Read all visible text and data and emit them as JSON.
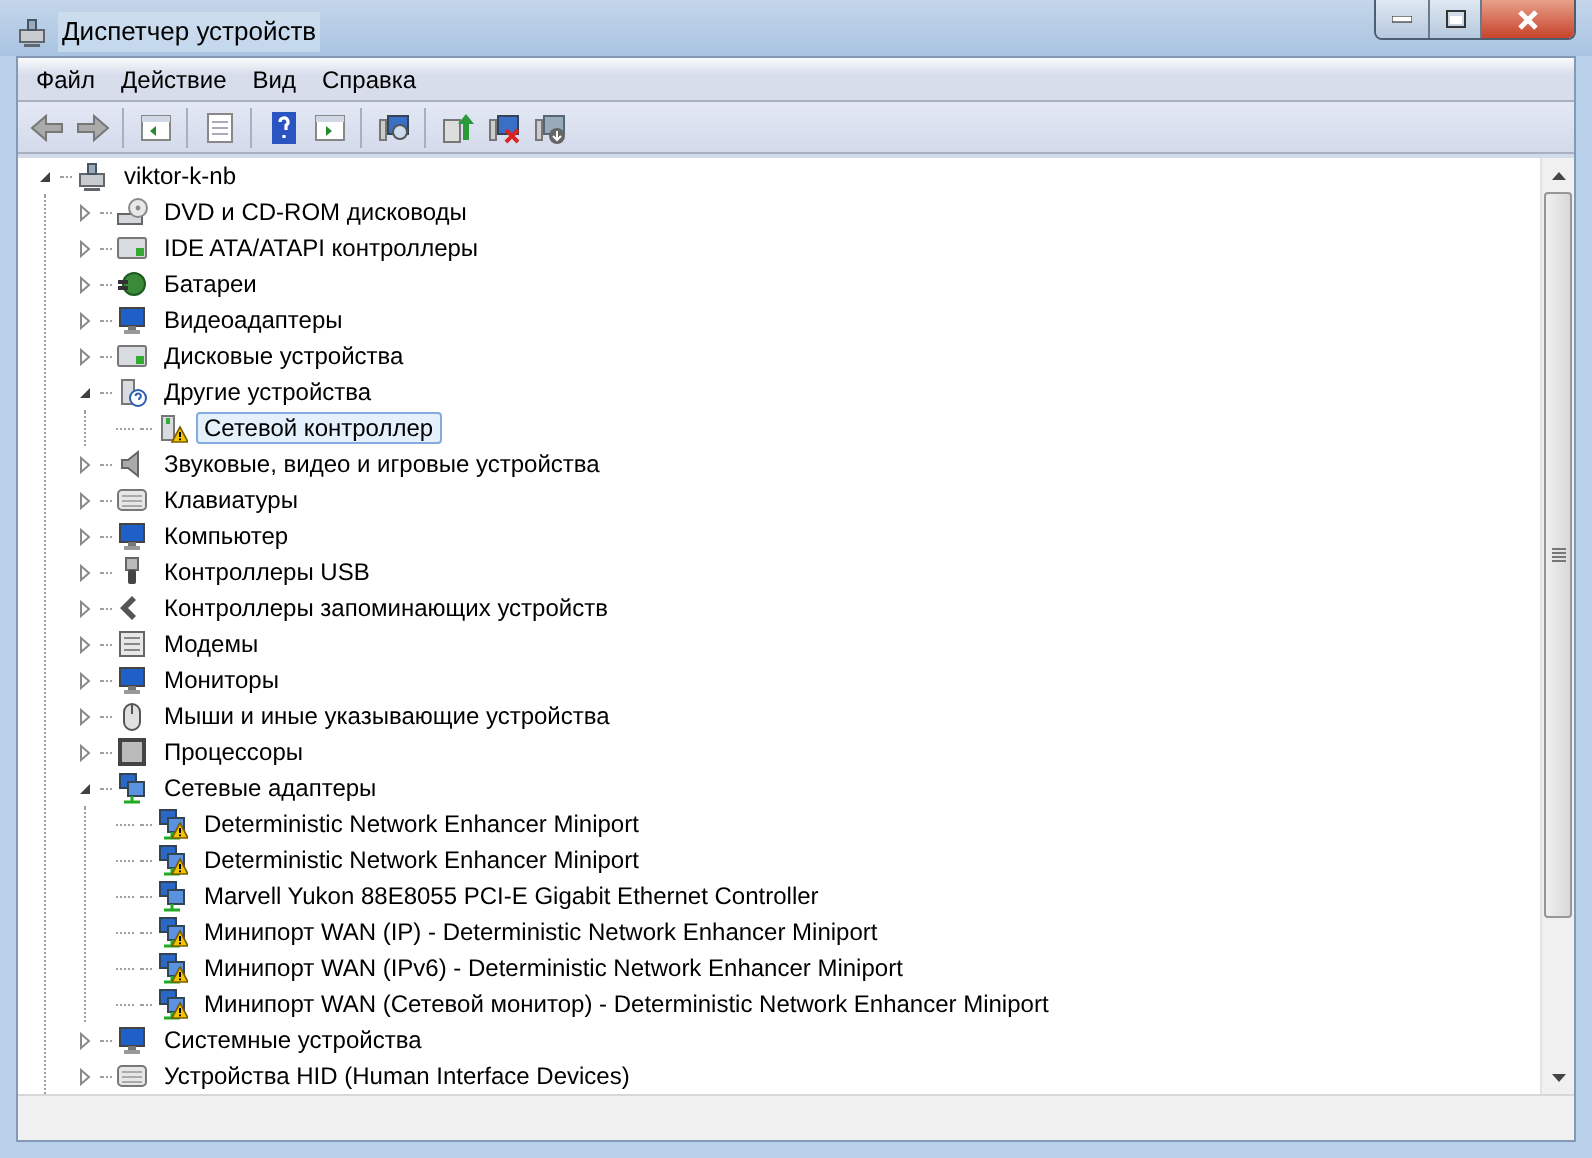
{
  "window": {
    "title": "Диспетчер устройств"
  },
  "menu": [
    "Файл",
    "Действие",
    "Вид",
    "Справка"
  ],
  "toolbar": [
    {
      "kind": "back",
      "disabled": true
    },
    {
      "kind": "forward",
      "disabled": true
    },
    {
      "kind": "sep"
    },
    {
      "kind": "panel"
    },
    {
      "kind": "sep"
    },
    {
      "kind": "properties"
    },
    {
      "kind": "sep"
    },
    {
      "kind": "help"
    },
    {
      "kind": "panel2"
    },
    {
      "kind": "sep"
    },
    {
      "kind": "scan"
    },
    {
      "kind": "sep"
    },
    {
      "kind": "update"
    },
    {
      "kind": "disable"
    },
    {
      "kind": "uninstall"
    }
  ],
  "tree": {
    "label": "viktor-k-nb",
    "kind": "computer",
    "expanded": true,
    "children": [
      {
        "label": "DVD и CD-ROM дисководы",
        "kind": "disc",
        "expanded": false
      },
      {
        "label": "IDE ATA/ATAPI контроллеры",
        "kind": "drive",
        "expanded": false
      },
      {
        "label": "Батареи",
        "kind": "battery",
        "expanded": false
      },
      {
        "label": "Видеоадаптеры",
        "kind": "monitor",
        "expanded": false
      },
      {
        "label": "Дисковые устройства",
        "kind": "drive",
        "expanded": false
      },
      {
        "label": "Другие устройства",
        "kind": "unknown",
        "expanded": true,
        "children": [
          {
            "label": "Сетевой контроллер",
            "kind": "device",
            "warning": true,
            "selected": true
          }
        ]
      },
      {
        "label": "Звуковые, видео и игровые устройства",
        "kind": "speaker",
        "expanded": false
      },
      {
        "label": "Клавиатуры",
        "kind": "keyboard",
        "expanded": false
      },
      {
        "label": "Компьютер",
        "kind": "monitor",
        "expanded": false
      },
      {
        "label": "Контроллеры USB",
        "kind": "usb",
        "expanded": false
      },
      {
        "label": "Контроллеры запоминающих устройств",
        "kind": "storage",
        "expanded": false
      },
      {
        "label": "Модемы",
        "kind": "modem",
        "expanded": false
      },
      {
        "label": "Мониторы",
        "kind": "monitor",
        "expanded": false
      },
      {
        "label": "Мыши и иные указывающие устройства",
        "kind": "mouse",
        "expanded": false
      },
      {
        "label": "Процессоры",
        "kind": "chip",
        "expanded": false
      },
      {
        "label": "Сетевые адаптеры",
        "kind": "network",
        "expanded": true,
        "children": [
          {
            "label": "Deterministic Network Enhancer Miniport",
            "kind": "network",
            "warning": true,
            "selected": false
          },
          {
            "label": "Deterministic Network Enhancer Miniport",
            "kind": "network",
            "warning": true,
            "selected": false
          },
          {
            "label": "Marvell Yukon 88E8055 PCI-E Gigabit Ethernet Controller",
            "kind": "network",
            "warning": false,
            "selected": false
          },
          {
            "label": "Минипорт WAN (IP) - Deterministic Network Enhancer Miniport",
            "kind": "network",
            "warning": true,
            "selected": false
          },
          {
            "label": "Минипорт WAN (IPv6) - Deterministic Network Enhancer Miniport",
            "kind": "network",
            "warning": true,
            "selected": false
          },
          {
            "label": "Минипорт WAN (Сетевой монитор) - Deterministic Network Enhancer Miniport",
            "kind": "network",
            "warning": true,
            "selected": false
          }
        ]
      },
      {
        "label": "Системные устройства",
        "kind": "monitor",
        "expanded": false
      },
      {
        "label": "Устройства HID (Human Interface Devices)",
        "kind": "keyboard",
        "expanded": false
      }
    ]
  }
}
